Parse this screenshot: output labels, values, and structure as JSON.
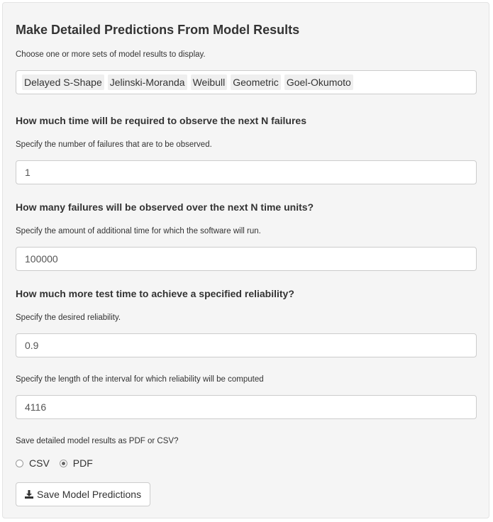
{
  "title": "Make Detailed Predictions From Model Results",
  "models": {
    "label": "Choose one or more sets of model results to display.",
    "selected": [
      "Delayed S-Shape",
      "Jelinski-Moranda",
      "Weibull",
      "Geometric",
      "Goel-Okumoto"
    ]
  },
  "sections": {
    "time_to_failures": {
      "heading": "How much time will be required to observe the next N failures",
      "label": "Specify the number of failures that are to be observed.",
      "value": "1"
    },
    "failures_over_time": {
      "heading": "How many failures will be observed over the next N time units?",
      "label": "Specify the amount of additional time for which the software will run.",
      "value": "100000"
    },
    "reliability": {
      "heading": "How much more test time to achieve a specified reliability?",
      "label": "Specify the desired reliability.",
      "value": "0.9",
      "interval_label": "Specify the length of the interval for which reliability will be computed",
      "interval_value": "4116"
    }
  },
  "save": {
    "label": "Save detailed model results as PDF or CSV?",
    "options": [
      "CSV",
      "PDF"
    ],
    "selected": "PDF",
    "button_label": "Save Model Predictions"
  }
}
